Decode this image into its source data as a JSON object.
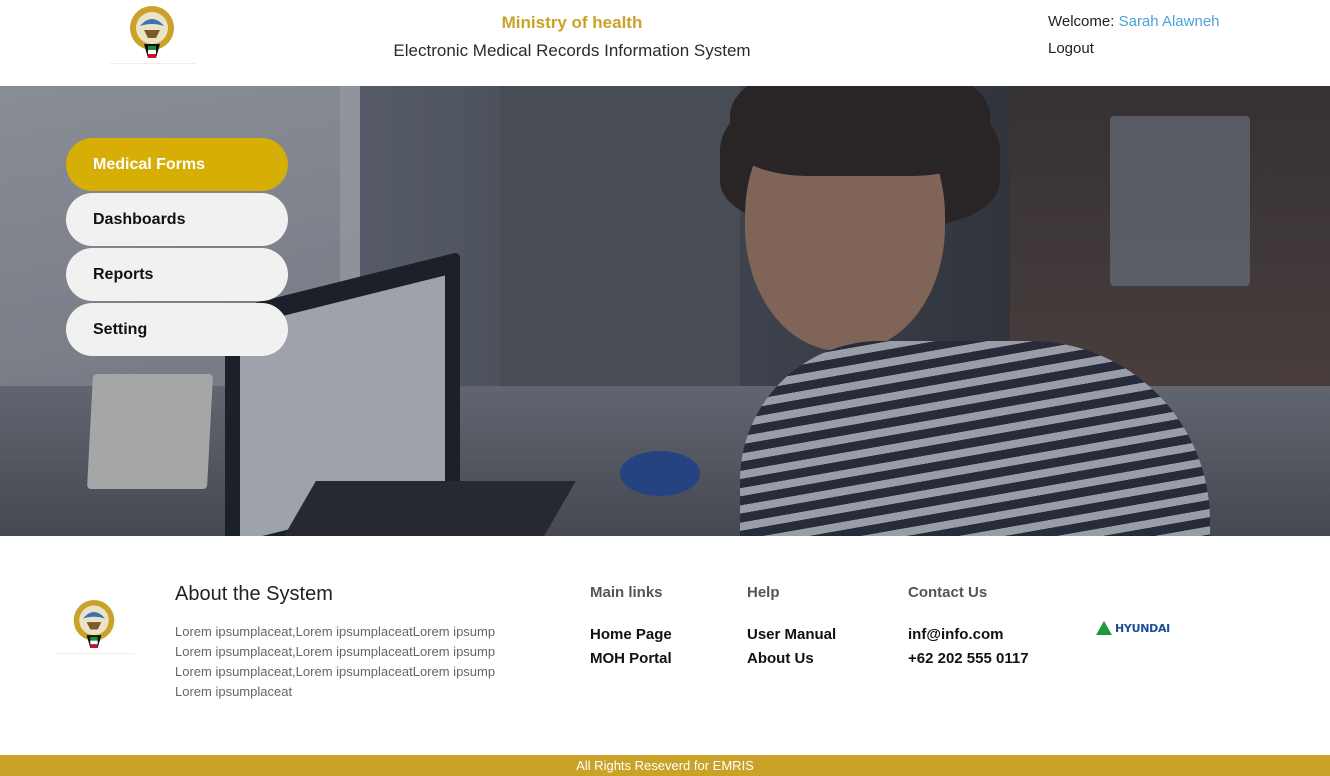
{
  "header": {
    "ministry": "Ministry of health",
    "system_title": "Electronic Medical Records Information System",
    "welcome_label": "Welcome:",
    "user_name": "Sarah Alawneh",
    "logout": "Logout"
  },
  "menu": {
    "items": [
      {
        "label": "Medical Forms",
        "active": true
      },
      {
        "label": "Dashboards",
        "active": false
      },
      {
        "label": "Reports",
        "active": false
      },
      {
        "label": "Setting",
        "active": false
      }
    ]
  },
  "footer": {
    "about_title": "About the System",
    "about_text": "Lorem ipsumplaceat,Lorem ipsumplaceatLorem ipsump Lorem ipsumplaceat,Lorem ipsumplaceatLorem ipsump Lorem ipsumplaceat,Lorem ipsumplaceatLorem ipsump Lorem ipsumplaceat",
    "main_links": {
      "title": "Main links",
      "links": [
        "Home Page",
        "MOH Portal"
      ]
    },
    "help": {
      "title": "Help",
      "links": [
        "User Manual",
        "About Us"
      ]
    },
    "contact": {
      "title": "Contact Us",
      "email": "inf@info.com",
      "phone": "+62 202 555 0117"
    },
    "partner_logo": "HYUNDAI",
    "copyright": "All Rights Reseverd for EMRIS"
  },
  "colors": {
    "accent_gold": "#c9a227",
    "menu_active": "#d6ae05",
    "user_link": "#4aa3d8"
  },
  "icons": [
    "emblem-logo",
    "hyundai-logo"
  ]
}
